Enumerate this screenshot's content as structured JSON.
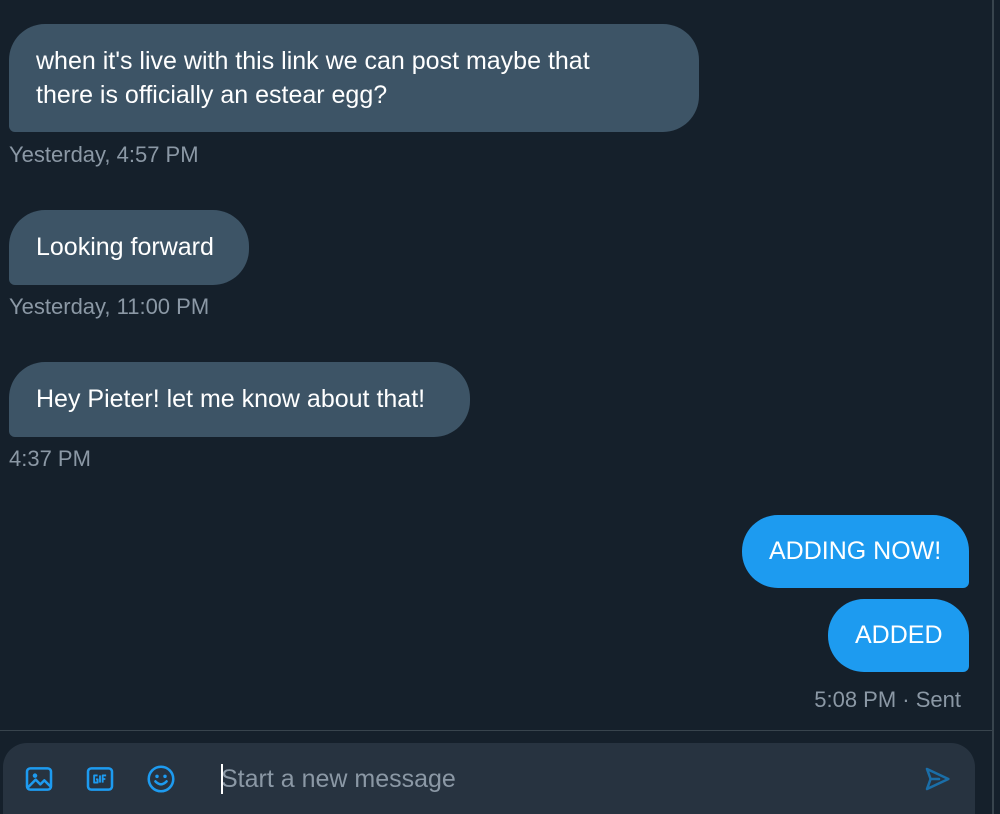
{
  "messages": [
    {
      "direction": "received",
      "lines": [
        "when it's live with this link we can post maybe that",
        "there is officially an estear egg?"
      ]
    },
    {
      "direction": "received",
      "text": "Looking forward"
    },
    {
      "direction": "received",
      "text": "Hey Pieter! let me know about that!"
    },
    {
      "direction": "sent",
      "text": "ADDING NOW!"
    },
    {
      "direction": "sent",
      "text": "ADDED"
    }
  ],
  "timestamps": {
    "first": "Yesterday, 4:57 PM",
    "second": "Yesterday, 11:00 PM",
    "third": "4:37 PM",
    "sent_status": "5:08 PM · Sent"
  },
  "composer": {
    "placeholder": "Start a new message",
    "value": "",
    "icons": [
      "media-icon",
      "gif-icon",
      "emoji-icon",
      "send-icon"
    ]
  },
  "colors": {
    "background": "#15202b",
    "received_bubble": "#3d5466",
    "sent_bubble": "#1d9bf0",
    "icon_accent": "#1d9bf0",
    "send_icon": "#1a6ea8",
    "muted_text": "#8b98a5"
  }
}
